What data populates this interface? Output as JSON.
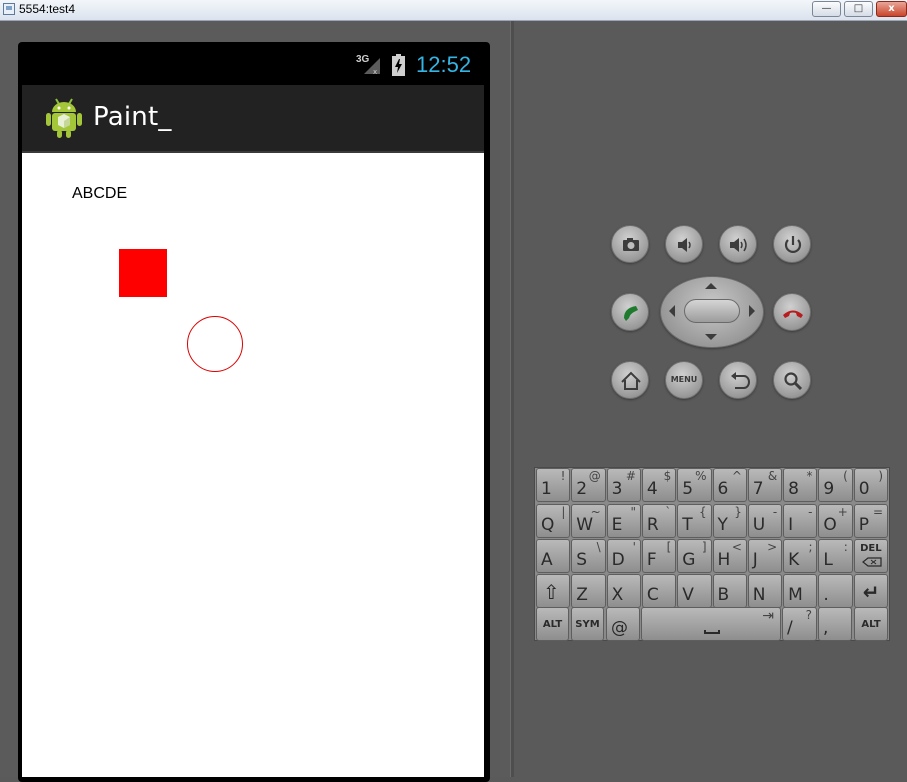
{
  "window": {
    "title": "5554:test4",
    "minimize_label": "—",
    "maximize_label": "□",
    "close_label": "x"
  },
  "phone": {
    "status": {
      "network_label": "3G",
      "time": "12:52"
    },
    "action_bar": {
      "app_title": "Paint_"
    },
    "canvas": {
      "text": "ABCDE",
      "square_color": "#ff0000",
      "circle_color": "#dd0000"
    }
  },
  "controls": {
    "icons": [
      "camera-icon",
      "volume-down-icon",
      "volume-up-icon",
      "power-icon",
      "call-icon",
      "end-call-icon",
      "home-icon",
      "back-icon",
      "search-icon"
    ],
    "menu_label": "MENU"
  },
  "keyboard": {
    "row1": [
      {
        "main": "1",
        "alt": "!"
      },
      {
        "main": "2",
        "alt": "@"
      },
      {
        "main": "3",
        "alt": "#"
      },
      {
        "main": "4",
        "alt": "$"
      },
      {
        "main": "5",
        "alt": "%"
      },
      {
        "main": "6",
        "alt": "^"
      },
      {
        "main": "7",
        "alt": "&"
      },
      {
        "main": "8",
        "alt": "*"
      },
      {
        "main": "9",
        "alt": "("
      },
      {
        "main": "0",
        "alt": ")"
      }
    ],
    "row2": [
      {
        "main": "Q",
        "alt": "|"
      },
      {
        "main": "W",
        "alt": "~"
      },
      {
        "main": "E",
        "alt": "\""
      },
      {
        "main": "R",
        "alt": "`"
      },
      {
        "main": "T",
        "alt": "{"
      },
      {
        "main": "Y",
        "alt": "}"
      },
      {
        "main": "U",
        "alt": "-"
      },
      {
        "main": "I",
        "alt": "-"
      },
      {
        "main": "O",
        "alt": "+"
      },
      {
        "main": "P",
        "alt": "="
      }
    ],
    "row3": [
      {
        "main": "A",
        "alt": ""
      },
      {
        "main": "S",
        "alt": "\\"
      },
      {
        "main": "D",
        "alt": "'"
      },
      {
        "main": "F",
        "alt": "["
      },
      {
        "main": "G",
        "alt": "]"
      },
      {
        "main": "H",
        "alt": "<"
      },
      {
        "main": "J",
        "alt": ">"
      },
      {
        "main": "K",
        "alt": ";"
      },
      {
        "main": "L",
        "alt": ":"
      },
      {
        "main": "DEL",
        "alt": ""
      }
    ],
    "row4": [
      {
        "main": "⇧",
        "alt": ""
      },
      {
        "main": "Z",
        "alt": ""
      },
      {
        "main": "X",
        "alt": ""
      },
      {
        "main": "C",
        "alt": ""
      },
      {
        "main": "V",
        "alt": ""
      },
      {
        "main": "B",
        "alt": ""
      },
      {
        "main": "N",
        "alt": ""
      },
      {
        "main": "M",
        "alt": ""
      },
      {
        "main": ".",
        "alt": ""
      },
      {
        "main": "↵",
        "alt": ""
      }
    ],
    "row5": {
      "alt_left": "ALT",
      "sym": "SYM",
      "at": "@",
      "space_tab": "⇥",
      "slash": "/",
      "question": "?",
      "comma": ",",
      "alt_right": "ALT"
    }
  }
}
